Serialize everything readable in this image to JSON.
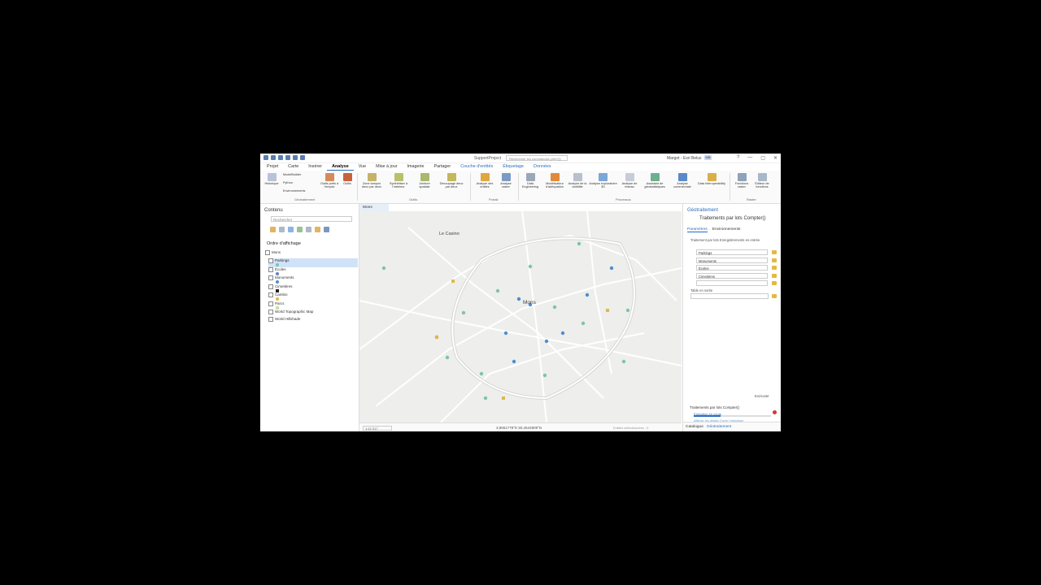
{
  "titlebar": {
    "app_title": "SupportProject",
    "search_placeholder": "Rechercher les commandes (Alt+Q)",
    "user": "Margot - Esri Belux",
    "user_initials": "MB",
    "controls": [
      "?",
      "—",
      "▢",
      "✕"
    ]
  },
  "tabs": [
    "Projet",
    "Carte",
    "Insérer",
    "Analyse",
    "Vue",
    "Mise à jour",
    "Imagerie",
    "Partager",
    "Couche d'entités",
    "Étiquetage",
    "Données"
  ],
  "active_tab": "Analyse",
  "ribbon": {
    "geotraitement": {
      "label": "Géotraitement",
      "historique": "Historique",
      "modelbuilder": "ModelBuilder",
      "python": "Python",
      "environnements": "Environnements",
      "outils_prets": "Outils prêts à l'emploi",
      "outils": "Outils"
    },
    "outils": {
      "label": "Outils",
      "zone_tampon": "Zone tampon deux par deux",
      "synthetiser": "Synthétiser à l'intérieur",
      "jointure": "Jointure spatiale",
      "decoupage": "Découpage deux par deux"
    },
    "portail": {
      "label": "Portail",
      "analyse_entites": "Analyse des entités",
      "analyse_raster": "Analyse raster"
    },
    "processus": {
      "label": "Processus",
      "data_engineering": "Data Engineering",
      "modelisateur": "Modélisateur d'adéquation",
      "visibilite": "Analyse de la visibilité",
      "exploratoire": "Analyse exploratoire 3D",
      "reseau": "Analyse de réseau",
      "assistant": "Assistant de géostatistiques",
      "commerciale": "Analyse commerciale",
      "interop": "Data Interoperability"
    },
    "raster": {
      "label": "Raster",
      "fonctions": "Fonctions raster",
      "editeur": "Éditeur de fonctions"
    }
  },
  "contents": {
    "title": "Contenu",
    "search_placeholder": "Rechercher",
    "draw_order": "Ordre d'affichage",
    "layers": [
      {
        "name": "Mons",
        "checked": true,
        "symbol": ""
      },
      {
        "name": "Parkings",
        "checked": true,
        "symbol": "#7cc4a9",
        "selected": true
      },
      {
        "name": "Écoles",
        "checked": true,
        "symbol": "#6a7fc4"
      },
      {
        "name": "Monuments",
        "checked": true,
        "symbol": "#4a8fd0"
      },
      {
        "name": "Cimetières",
        "checked": true,
        "symbol": "#222222"
      },
      {
        "name": "Cambio",
        "checked": true,
        "symbol": "#e0b84a"
      },
      {
        "name": "Parcs",
        "checked": true,
        "symbol": "#c6e3a5"
      },
      {
        "name": "World Topographic Map",
        "checked": true,
        "symbol": ""
      },
      {
        "name": "World Hillshade",
        "checked": true,
        "symbol": ""
      }
    ]
  },
  "map": {
    "tab": "Mons",
    "labels": {
      "city": "Mons",
      "casino": "Le Casino"
    },
    "scale": "1:12 017",
    "coords": "3,9651778°E 50,4544809°N",
    "selected": "Entités sélectionnées : 0"
  },
  "geoprocessing": {
    "title": "Géotraitement",
    "tool": "Traitements par lots Compter()",
    "tabs": [
      "Paramètres",
      "Environnements"
    ],
    "param_label": "Traitement par lots Enregistrements en entrée",
    "inputs": [
      "Parkings",
      "Monuments",
      "Écoles",
      "Cimetières",
      ""
    ],
    "output_label": "Table en sortie",
    "run": "Exécuter",
    "history": "Traitements par lots Compter()",
    "progress": "Exécution en cours",
    "progress_value": 0.35,
    "links": "Afficher les détails   Ouvrir l'historique",
    "bottom_tabs": [
      "Catalogue",
      "Géotraitement"
    ]
  }
}
